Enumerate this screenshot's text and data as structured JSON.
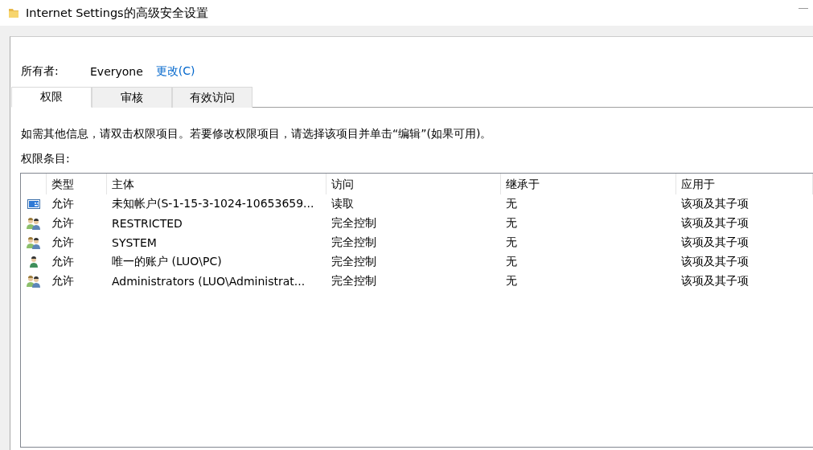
{
  "window": {
    "title": "Internet Settings的高级安全设置"
  },
  "owner": {
    "label": "所有者:",
    "value": "Everyone",
    "change_link": "更改(C)"
  },
  "tabs": [
    {
      "label": "权限",
      "selected": true
    },
    {
      "label": "审核",
      "selected": false
    },
    {
      "label": "有效访问",
      "selected": false
    }
  ],
  "info_text": "如需其他信息，请双击权限项目。若要修改权限项目，请选择该项目并单击“编辑”(如果可用)。",
  "list_label": "权限条目:",
  "table": {
    "columns": [
      "类型",
      "主体",
      "访问",
      "继承于",
      "应用于"
    ],
    "rows": [
      {
        "kind": "app",
        "type": "允许",
        "principal": "未知帐户(S-1-15-3-1024-10653659...",
        "access": "读取",
        "inherited_from": "无",
        "applies_to": "该项及其子项"
      },
      {
        "kind": "group",
        "type": "允许",
        "principal": "RESTRICTED",
        "access": "完全控制",
        "inherited_from": "无",
        "applies_to": "该项及其子项"
      },
      {
        "kind": "group",
        "type": "允许",
        "principal": "SYSTEM",
        "access": "完全控制",
        "inherited_from": "无",
        "applies_to": "该项及其子项"
      },
      {
        "kind": "user",
        "type": "允许",
        "principal": "唯一的账户 (LUO\\PC)",
        "access": "完全控制",
        "inherited_from": "无",
        "applies_to": "该项及其子项"
      },
      {
        "kind": "group",
        "type": "允许",
        "principal": "Administrators (LUO\\Administrat...",
        "access": "完全控制",
        "inherited_from": "无",
        "applies_to": "该项及其子项"
      }
    ]
  }
}
